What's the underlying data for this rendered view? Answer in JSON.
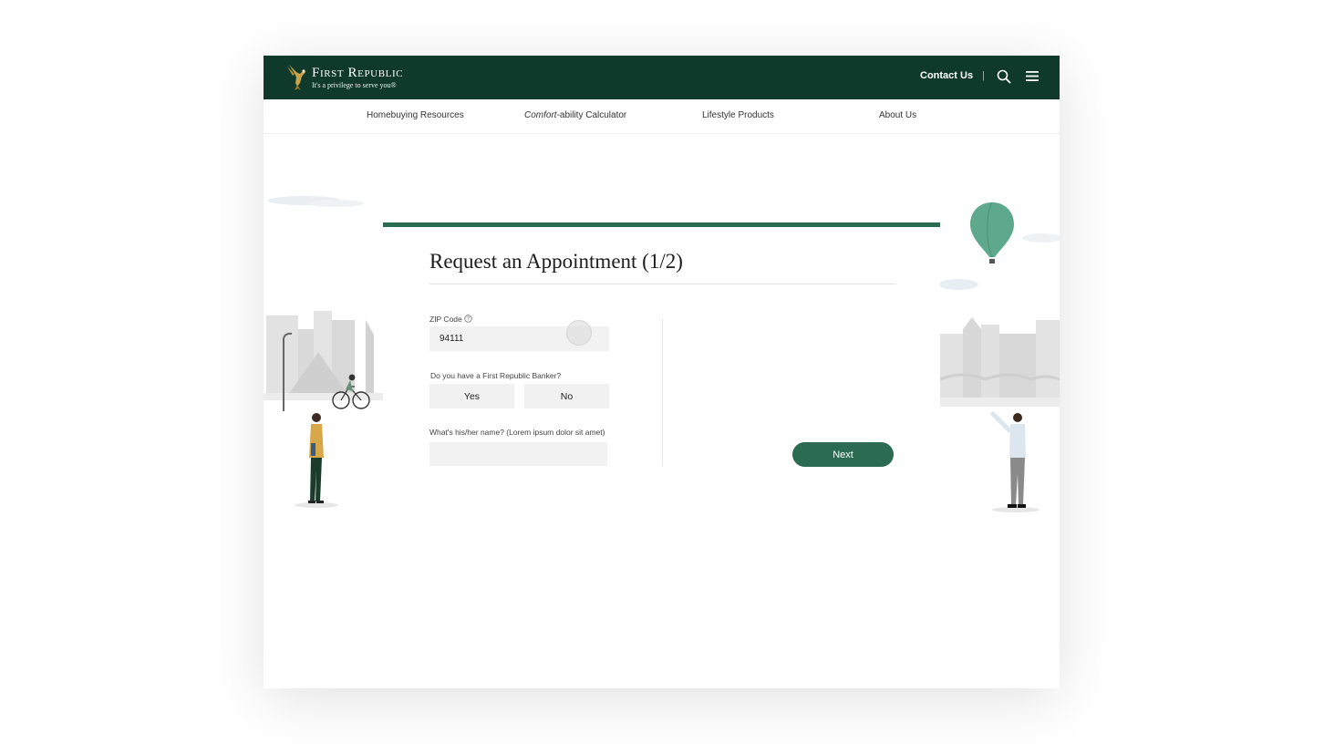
{
  "header": {
    "brand_name": "First Republic",
    "brand_tagline": "It's a privilege to serve you®",
    "contact_label": "Contact Us",
    "separator": "|",
    "icons": [
      "eagle-logo-icon",
      "search-icon",
      "hamburger-menu-icon"
    ]
  },
  "nav": {
    "items": [
      {
        "label": "Homebuying Resources"
      },
      {
        "label_em": "Comfort",
        "label_rest": "-ability Calculator"
      },
      {
        "label": "Lifestyle Products"
      },
      {
        "label": "About Us"
      }
    ]
  },
  "form": {
    "progress_fraction": 1,
    "title": "Request an Appointment (1/2)",
    "zip": {
      "label": "ZIP Code",
      "value": "94111"
    },
    "banker_question": "Do you have a First Republic Banker?",
    "yes_label": "Yes",
    "no_label": "No",
    "name_label": "What's his/her name? (Lorem ipsum dolor sit amet)",
    "name_value": "",
    "next_label": "Next"
  },
  "colors": {
    "brand_green": "#0f3a2b",
    "accent_green": "#2a6b52",
    "balloon": "#5ea98c",
    "input_bg": "#f2f2f2"
  }
}
